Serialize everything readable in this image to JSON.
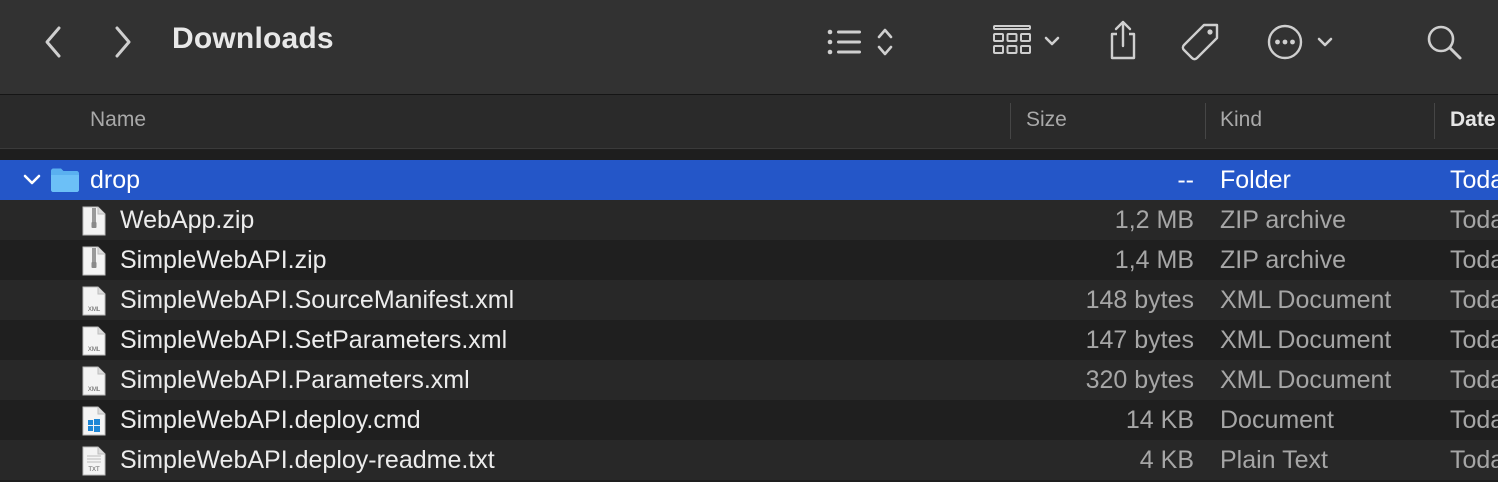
{
  "window": {
    "title": "Downloads"
  },
  "toolbar": {
    "back_icon": "chevron-left-icon",
    "forward_icon": "chevron-right-icon",
    "view_list_icon": "list-icon",
    "group_icon": "grid-icon",
    "share_icon": "share-icon",
    "tag_icon": "tag-icon",
    "more_icon": "ellipsis-circle-icon",
    "search_icon": "search-icon"
  },
  "columns": {
    "name": "Name",
    "size": "Size",
    "kind": "Kind",
    "date": "Date"
  },
  "rows": [
    {
      "name": "drop",
      "size": "--",
      "kind": "Folder",
      "date": "Today",
      "type": "folder",
      "expanded": true,
      "selected": true
    },
    {
      "name": "WebApp.zip",
      "size": "1,2 MB",
      "kind": "ZIP archive",
      "date": "Today",
      "type": "zip"
    },
    {
      "name": "SimpleWebAPI.zip",
      "size": "1,4 MB",
      "kind": "ZIP archive",
      "date": "Today",
      "type": "zip"
    },
    {
      "name": "SimpleWebAPI.SourceManifest.xml",
      "size": "148 bytes",
      "kind": "XML Document",
      "date": "Today",
      "type": "xml",
      "badge": "XML"
    },
    {
      "name": "SimpleWebAPI.SetParameters.xml",
      "size": "147 bytes",
      "kind": "XML Document",
      "date": "Today",
      "type": "xml",
      "badge": "XML"
    },
    {
      "name": "SimpleWebAPI.Parameters.xml",
      "size": "320 bytes",
      "kind": "XML Document",
      "date": "Today",
      "type": "xml",
      "badge": "XML"
    },
    {
      "name": "SimpleWebAPI.deploy.cmd",
      "size": "14 KB",
      "kind": "Document",
      "date": "Today",
      "type": "cmd"
    },
    {
      "name": "SimpleWebAPI.deploy-readme.txt",
      "size": "4 KB",
      "kind": "Plain Text",
      "date": "Today",
      "type": "txt",
      "badge": "TXT"
    }
  ],
  "colors": {
    "selection": "#2456c8",
    "toolbar": "#323232",
    "folder": "#5ab0f0"
  }
}
